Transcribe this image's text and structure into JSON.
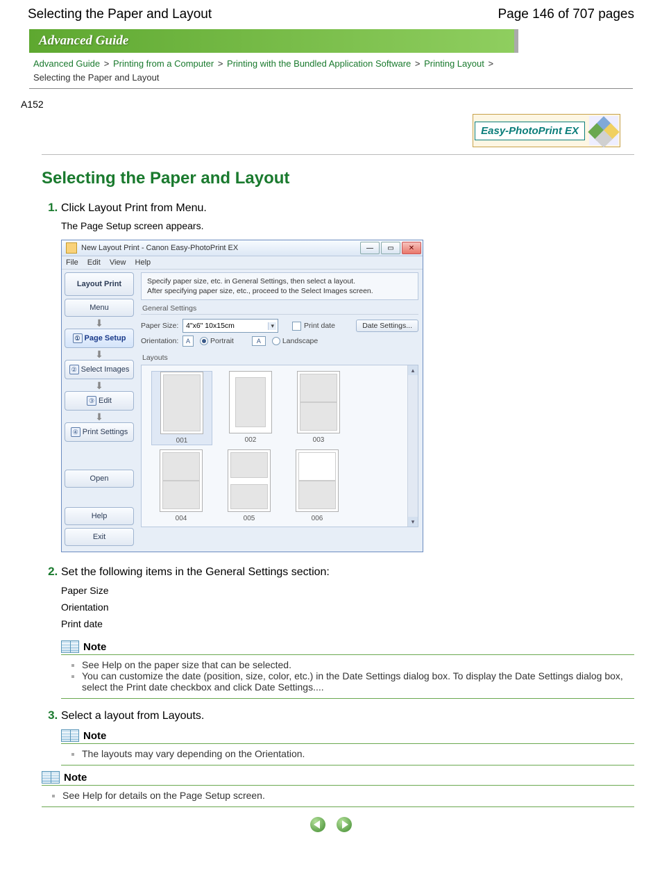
{
  "header": {
    "page_title": "Selecting the Paper and Layout",
    "page_indicator": "Page 146 of 707 pages"
  },
  "banner": "Advanced Guide",
  "breadcrumbs": {
    "items": [
      "Advanced Guide",
      "Printing from a Computer",
      "Printing with the Bundled Application Software",
      "Printing Layout"
    ],
    "current": "Selecting the Paper and Layout",
    "sep": ">"
  },
  "ref_code": "A152",
  "product_logo": "Easy-PhotoPrint EX",
  "h1": "Selecting the Paper and Layout",
  "steps": {
    "s1": {
      "text": "Click Layout Print from Menu.",
      "sub": "The Page Setup screen appears."
    },
    "s2": {
      "text": "Set the following items in the General Settings section:",
      "items": [
        "Paper Size",
        "Orientation",
        "Print date"
      ]
    },
    "s3": {
      "text": "Select a layout from Layouts."
    }
  },
  "note1": {
    "title": "Note",
    "items": [
      "See Help on the paper size that can be selected.",
      "You can customize the date (position, size, color, etc.) in the Date Settings dialog box. To display the Date Settings dialog box, select the Print date checkbox and click Date Settings...."
    ]
  },
  "note2": {
    "title": "Note",
    "items": [
      "The layouts may vary depending on the Orientation."
    ]
  },
  "note3": {
    "title": "Note",
    "items": [
      "See Help for details on the Page Setup screen."
    ]
  },
  "app": {
    "title": "New Layout Print - Canon Easy-PhotoPrint EX",
    "menu": [
      "File",
      "Edit",
      "View",
      "Help"
    ],
    "sidebar": {
      "main": "Layout Print",
      "menu": "Menu",
      "steps": {
        "s1": "Page Setup",
        "s2": "Select Images",
        "s3": "Edit",
        "s4": "Print Settings"
      },
      "open": "Open",
      "help": "Help",
      "exit": "Exit"
    },
    "instr1": "Specify paper size, etc. in General Settings, then select a layout.",
    "instr2": "After specifying paper size, etc., proceed to the Select Images screen.",
    "general": {
      "heading": "General Settings",
      "paper_label": "Paper Size:",
      "paper_value": "4\"x6\" 10x15cm",
      "orient_label": "Orientation:",
      "portrait": "Portrait",
      "landscape": "Landscape",
      "printdate": "Print date",
      "datesettings": "Date Settings..."
    },
    "layouts": {
      "heading": "Layouts",
      "items": [
        "001",
        "002",
        "003",
        "004",
        "005",
        "006"
      ]
    }
  }
}
